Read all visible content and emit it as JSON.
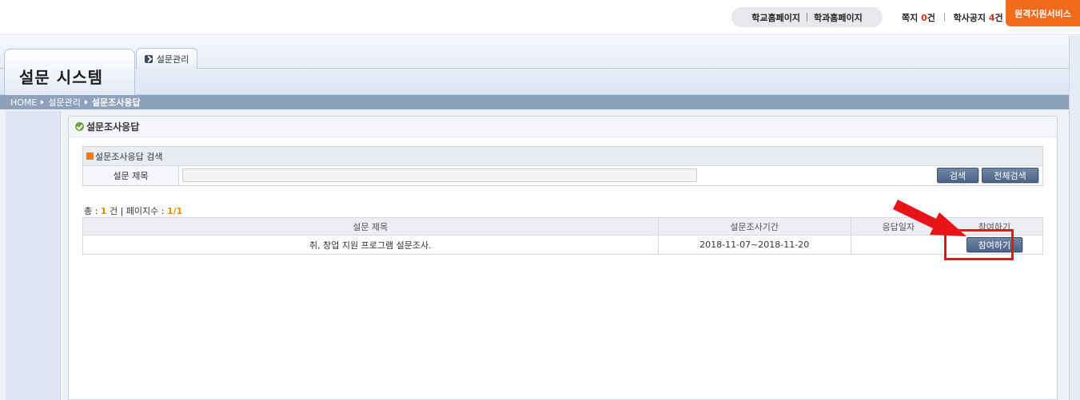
{
  "topbar": {
    "school_home": "학교홈페이지",
    "dept_home": "학과홈페이지",
    "messages_label": "쪽지",
    "messages_count": "0",
    "messages_unit": "건",
    "notices_label": "학사공지",
    "notices_count": "4",
    "notices_unit": "건",
    "remote_support": "원격지원서비스"
  },
  "header": {
    "system_title": "설문 시스템",
    "menu_tab": "설문관리"
  },
  "breadcrumb": {
    "home": "HOME",
    "level1": "설문관리",
    "current": "설문조사응답"
  },
  "page": {
    "title": "설문조사응답"
  },
  "search": {
    "panel_title": "설문조사응답 검색",
    "label": "설문 제목",
    "value": "",
    "search_button": "검색",
    "search_all_button": "전체검색"
  },
  "summary": {
    "total_label": "총 :",
    "total_count": "1",
    "total_unit": "건",
    "pages_label": "| 페이지수 :",
    "pages_value": "1/1"
  },
  "table": {
    "headers": [
      "설문 제목",
      "설문조사기간",
      "응답일자",
      "참여하기"
    ],
    "rows": [
      {
        "title": "취, 창업 지원 프로그램 설문조사.",
        "period": "2018-11-07~2018-11-20",
        "response_date": "",
        "action": "참여하기"
      }
    ]
  },
  "annotation": {
    "highlight_color": "#e8141a"
  }
}
